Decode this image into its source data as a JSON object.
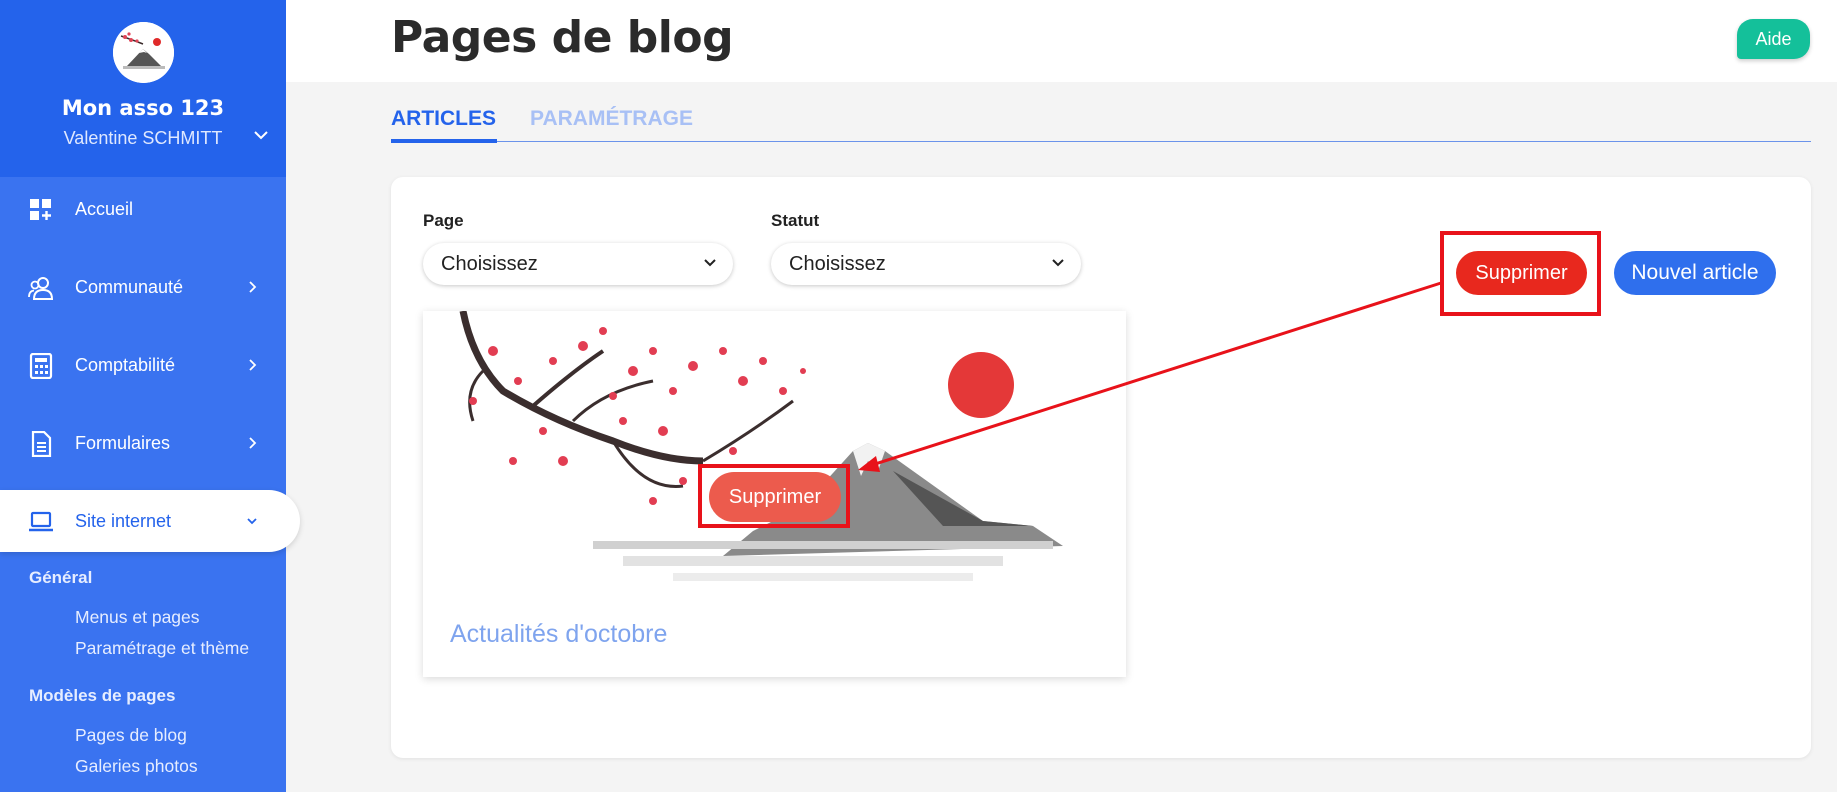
{
  "sidebar": {
    "org_name": "Mon asso 123",
    "user_name": "Valentine SCHMITT",
    "items": [
      {
        "label": "Accueil",
        "icon": "dashboard-icon"
      },
      {
        "label": "Communauté",
        "icon": "users-icon"
      },
      {
        "label": "Comptabilité",
        "icon": "calculator-icon"
      },
      {
        "label": "Formulaires",
        "icon": "document-icon"
      },
      {
        "label": "Site internet",
        "icon": "laptop-icon",
        "active": true
      }
    ],
    "sections": [
      {
        "title": "Général",
        "links": [
          "Menus et pages",
          "Paramétrage et thème"
        ]
      },
      {
        "title": "Modèles de pages",
        "links": [
          "Pages de blog",
          "Galeries photos"
        ]
      }
    ]
  },
  "header": {
    "title": "Pages de blog",
    "help_label": "Aide"
  },
  "tabs": [
    {
      "label": "ARTICLES",
      "active": true
    },
    {
      "label": "PARAMÉTRAGE",
      "active": false
    }
  ],
  "filters": {
    "page_label": "Page",
    "page_value": "Choisissez",
    "status_label": "Statut",
    "status_value": "Choisissez"
  },
  "actions": {
    "delete_label": "Supprimer",
    "new_article_label": "Nouvel article"
  },
  "articles": [
    {
      "title": "Actualités d'octobre",
      "overlay_delete_label": "Supprimer"
    }
  ],
  "colors": {
    "sidebar": "#3a73f0",
    "primary": "#2463eb",
    "danger": "#e8281e",
    "help": "#14c09a",
    "annotation": "#e8121a"
  }
}
